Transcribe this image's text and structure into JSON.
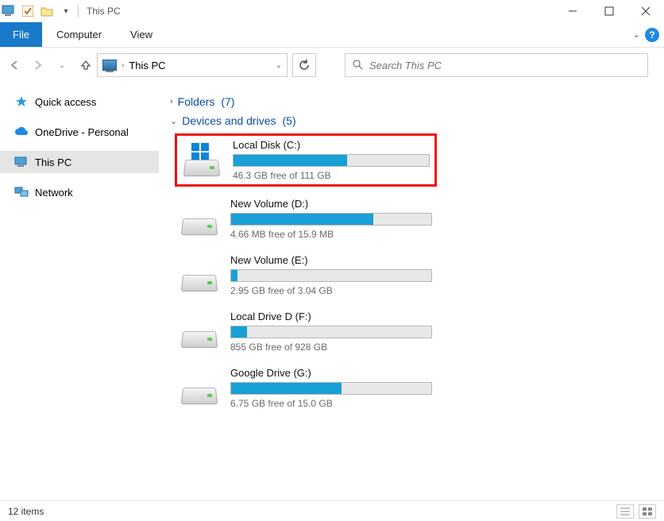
{
  "window": {
    "title": "This PC",
    "minimize_label": "Minimize",
    "maximize_label": "Maximize",
    "close_label": "Close"
  },
  "ribbon": {
    "file": "File",
    "tabs": [
      "Computer",
      "View"
    ]
  },
  "nav": {
    "location": "This PC",
    "refresh_tooltip": "Refresh"
  },
  "search": {
    "placeholder": "Search This PC"
  },
  "sidebar": {
    "items": [
      {
        "label": "Quick access",
        "icon": "star"
      },
      {
        "label": "OneDrive - Personal",
        "icon": "cloud"
      },
      {
        "label": "This PC",
        "icon": "pc",
        "selected": true
      },
      {
        "label": "Network",
        "icon": "network"
      }
    ]
  },
  "groups": {
    "folders": {
      "label": "Folders",
      "count": "(7)",
      "expanded": false
    },
    "devices": {
      "label": "Devices and drives",
      "count": "(5)",
      "expanded": true
    }
  },
  "drives": [
    {
      "name": "Local Disk (C:)",
      "free_text": "46.3 GB free of 111 GB",
      "fill_pct": 58,
      "highlight": true,
      "os": true
    },
    {
      "name": "New Volume (D:)",
      "free_text": "4.66 MB free of 15.9 MB",
      "fill_pct": 71,
      "highlight": false,
      "os": false
    },
    {
      "name": "New Volume (E:)",
      "free_text": "2.95 GB free of 3.04 GB",
      "fill_pct": 3,
      "highlight": false,
      "os": false
    },
    {
      "name": "Local Drive D (F:)",
      "free_text": "855 GB free of 928 GB",
      "fill_pct": 8,
      "highlight": false,
      "os": false
    },
    {
      "name": "Google Drive (G:)",
      "free_text": "6.75 GB free of 15.0 GB",
      "fill_pct": 55,
      "highlight": false,
      "os": false
    }
  ],
  "status": {
    "item_count": "12 items"
  }
}
